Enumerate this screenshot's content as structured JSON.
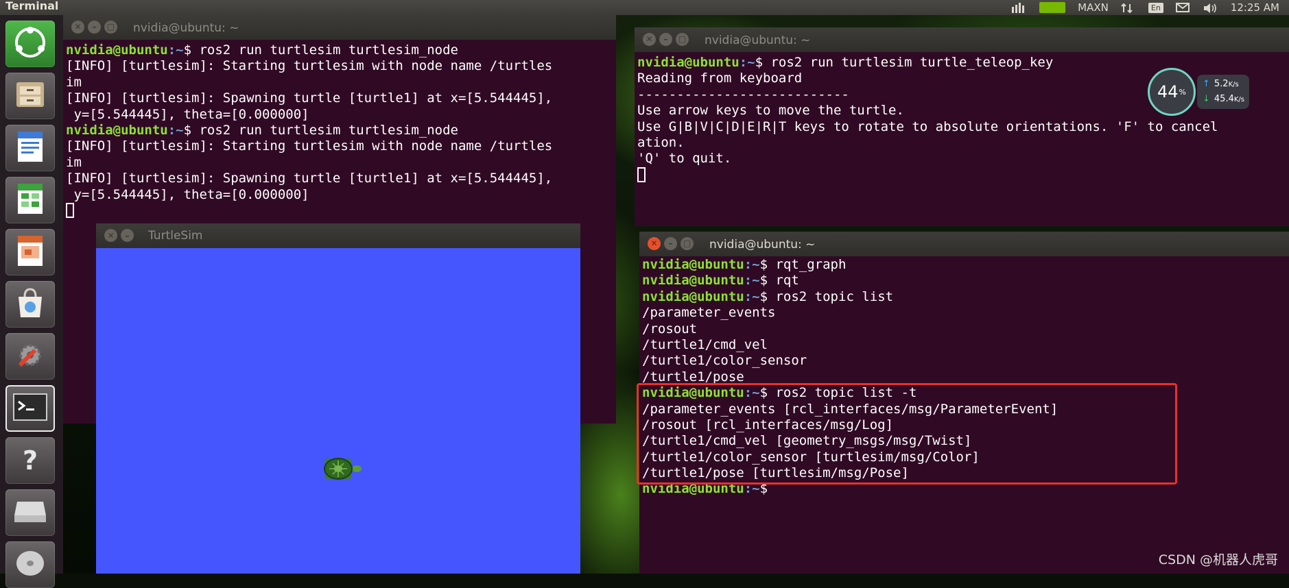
{
  "panel": {
    "title": "Terminal",
    "gpu_mode": "MAXN",
    "lang": "En",
    "clock": "12:25 AM"
  },
  "terminal1": {
    "title": "nvidia@ubuntu: ~",
    "lines": [
      {
        "user": "nvidia@ubuntu",
        "path": ":~",
        "cmd": "$ ros2 run turtlesim turtlesim_node"
      },
      {
        "text": "[INFO] [turtlesim]: Starting turtlesim with node name /turtles"
      },
      {
        "text": "im"
      },
      {
        "text": "[INFO] [turtlesim]: Spawning turtle [turtle1] at x=[5.544445],"
      },
      {
        "text": " y=[5.544445], theta=[0.000000]"
      },
      {
        "user": "nvidia@ubuntu",
        "path": ":~",
        "cmd": "$ ros2 run turtlesim turtlesim_node"
      },
      {
        "text": "[INFO] [turtlesim]: Starting turtlesim with node name /turtles"
      },
      {
        "text": "im"
      },
      {
        "text": "[INFO] [turtlesim]: Spawning turtle [turtle1] at x=[5.544445],"
      },
      {
        "text": " y=[5.544445], theta=[0.000000]"
      }
    ]
  },
  "terminal2": {
    "title": "nvidia@ubuntu: ~",
    "lines": [
      {
        "user": "nvidia@ubuntu",
        "path": ":~",
        "cmd": "$ ros2 run turtlesim turtle_teleop_key"
      },
      {
        "text": "Reading from keyboard"
      },
      {
        "text": "---------------------------"
      },
      {
        "text": "Use arrow keys to move the turtle."
      },
      {
        "text": "Use G|B|V|C|D|E|R|T keys to rotate to absolute orientations. 'F' to cancel"
      },
      {
        "text": "ation."
      },
      {
        "text": "'Q' to quit."
      }
    ]
  },
  "terminal3": {
    "title": "nvidia@ubuntu: ~",
    "lines": [
      {
        "user": "nvidia@ubuntu",
        "path": ":~",
        "cmd": "$ rqt_graph"
      },
      {
        "user": "nvidia@ubuntu",
        "path": ":~",
        "cmd": "$ rqt"
      },
      {
        "user": "nvidia@ubuntu",
        "path": ":~",
        "cmd": "$ ros2 topic list"
      },
      {
        "text": "/parameter_events"
      },
      {
        "text": "/rosout"
      },
      {
        "text": "/turtle1/cmd_vel"
      },
      {
        "text": "/turtle1/color_sensor"
      },
      {
        "text": "/turtle1/pose"
      },
      {
        "user": "nvidia@ubuntu",
        "path": ":~",
        "cmd": "$ ros2 topic list -t"
      },
      {
        "text": "/parameter_events [rcl_interfaces/msg/ParameterEvent]"
      },
      {
        "text": "/rosout [rcl_interfaces/msg/Log]"
      },
      {
        "text": "/turtle1/cmd_vel [geometry_msgs/msg/Twist]"
      },
      {
        "text": "/turtle1/color_sensor [turtlesim/msg/Color]"
      },
      {
        "text": "/turtle1/pose [turtlesim/msg/Pose]"
      },
      {
        "user": "nvidia@ubuntu",
        "path": ":~",
        "cmd": "$"
      }
    ]
  },
  "turtlesim": {
    "title": "TurtleSim",
    "background_color": "#4556ff"
  },
  "netmon": {
    "cpu_value": "44",
    "cpu_unit": "%",
    "up_value": "5.2",
    "up_unit": "K/s",
    "down_value": "45.4",
    "down_unit": "K/s"
  },
  "watermark": "CSDN @机器人虎哥"
}
